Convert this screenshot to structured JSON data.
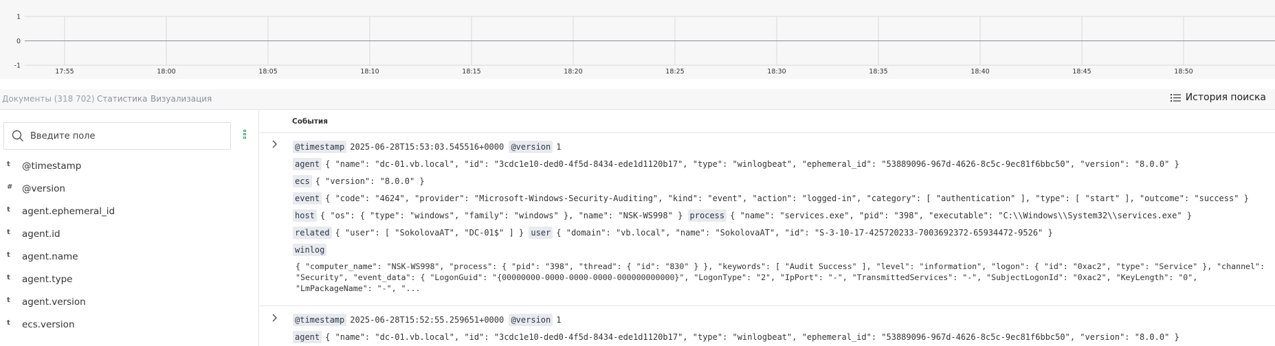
{
  "chart": {
    "y_ticks": [
      "1",
      "0",
      "-1"
    ],
    "x_ticks": [
      "17:55",
      "18:00",
      "18:05",
      "18:10",
      "18:15",
      "18:20",
      "18:25",
      "18:30",
      "18:35",
      "18:40",
      "18:45",
      "18:50"
    ],
    "ylim": [
      -1,
      1
    ]
  },
  "tabs": [
    {
      "label": "Документы (318 702)",
      "active": true
    },
    {
      "label": "Статистика",
      "active": false
    },
    {
      "label": "Визуализация",
      "active": false
    }
  ],
  "history_button": {
    "label": "История поиска",
    "icon": "list-icon"
  },
  "sidebar": {
    "search_placeholder": "Введите поле",
    "fields": [
      {
        "type": "t",
        "name": "@timestamp"
      },
      {
        "type": "#",
        "name": "@version"
      },
      {
        "type": "t",
        "name": "agent.ephemeral_id"
      },
      {
        "type": "t",
        "name": "agent.id"
      },
      {
        "type": "t",
        "name": "agent.name"
      },
      {
        "type": "t",
        "name": "agent.type"
      },
      {
        "type": "t",
        "name": "agent.version"
      },
      {
        "type": "t",
        "name": "ecs.version"
      }
    ]
  },
  "events_header": "События",
  "events": [
    {
      "timestamp_key": "@timestamp",
      "timestamp": "2025-06-28T15:53:03.545516+0000",
      "version_key": "@version",
      "version": "1",
      "agent_key": "agent",
      "agent": "{ \"name\": \"dc-01.vb.local\", \"id\": \"3cdc1e10-ded0-4f5d-8434-ede1d1120b17\", \"type\": \"winlogbeat\", \"ephemeral_id\": \"53889096-967d-4626-8c5c-9ec81f6bbc50\", \"version\": \"8.0.0\" }",
      "ecs_key": "ecs",
      "ecs": "{ \"version\": \"8.0.0\" }",
      "event_key": "event",
      "event": "{ \"code\": \"4624\", \"provider\": \"Microsoft-Windows-Security-Auditing\", \"kind\": \"event\", \"action\": \"logged-in\", \"category\": [ \"authentication\" ], \"type\": [ \"start\" ], \"outcome\": \"success\" }",
      "host_key": "host",
      "host": "{ \"os\": { \"type\": \"windows\", \"family\": \"windows\" }, \"name\": \"NSK-WS998\" }",
      "process_key": "process",
      "process": "{ \"name\": \"services.exe\", \"pid\": \"398\", \"executable\": \"C:\\\\Windows\\\\System32\\\\services.exe\" }",
      "related_key": "related",
      "related": "{ \"user\": [ \"SokolovaAT\", \"DC-01$\" ] }",
      "user_key": "user",
      "user": "{ \"domain\": \"vb.local\", \"name\": \"SokolovaAT\", \"id\": \"S-3-10-17-425720233-7003692372-65934472-9526\" }",
      "winlog_key": "winlog",
      "winlog": "{ \"computer_name\": \"NSK-WS998\", \"process\": { \"pid\": \"398\", \"thread\": { \"id\": \"830\" } }, \"keywords\": [ \"Audit Success\" ], \"level\": \"information\", \"logon\": { \"id\": \"0xac2\", \"type\": \"Service\" }, \"channel\": \"Security\", \"event_data\": { \"LogonGuid\": \"{00000000-0000-0000-0000-000000000000}\", \"LogonType\": \"2\", \"IpPort\": \"-\", \"TransmittedServices\": \"-\", \"SubjectLogonId\": \"0xac2\", \"KeyLength\": \"0\", \"LmPackageName\": \"-\", \"..."
    },
    {
      "timestamp_key": "@timestamp",
      "timestamp": "2025-06-28T15:52:55.259651+0000",
      "version_key": "@version",
      "version": "1",
      "agent_key": "agent",
      "agent": "{ \"name\": \"dc-01.vb.local\", \"id\": \"3cdc1e10-ded0-4f5d-8434-ede1d1120b17\", \"type\": \"winlogbeat\", \"ephemeral_id\": \"53889096-967d-4626-8c5c-9ec81f6bbc50\", \"version\": \"8.0.0\" }"
    }
  ]
}
